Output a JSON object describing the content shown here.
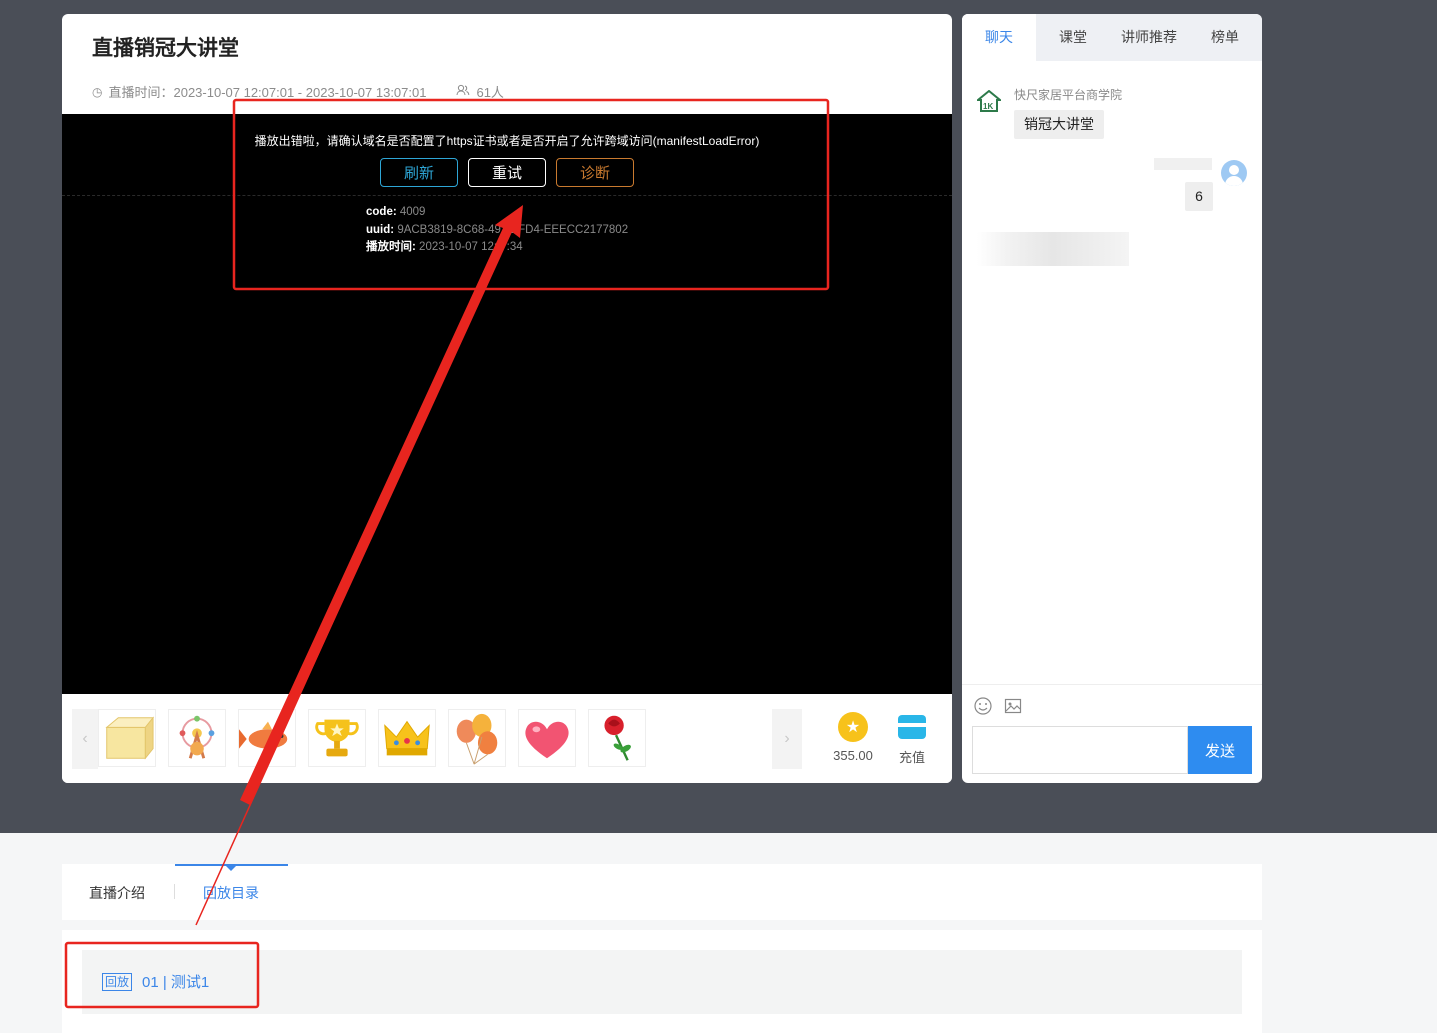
{
  "live": {
    "title": "直播销冠大讲堂",
    "time_label": "直播时间：2023-10-07 12:07:01 - 2023-10-07 13:07:01",
    "viewers": "61人"
  },
  "player_error": {
    "message": "播放出错啦，请确认域名是否配置了https证书或者是否开启了允许跨域访问(manifestLoadError)",
    "buttons": {
      "refresh": "刷新",
      "retry": "重试",
      "diagnose": "诊断"
    },
    "code_label": "code:",
    "code_value": "4009",
    "uuid_label": "uuid:",
    "uuid_value": "9ACB3819-8C68-491 BFD4-EEECC2177802",
    "time_label": "播放时间:",
    "time_value": "2023-10-07 12:2 :34"
  },
  "gifts": [
    "gift-box",
    "ferris-wheel",
    "koi-fish",
    "trophy",
    "crown",
    "balloons",
    "heart",
    "rose"
  ],
  "wallet": {
    "balance": "355.00",
    "recharge_label": "充值"
  },
  "chat": {
    "tabs": [
      "聊天",
      "课堂",
      "讲师推荐",
      "榜单"
    ],
    "active_tab": "聊天",
    "messages": [
      {
        "sender": "快尺家居平台商学院",
        "text": "销冠大讲堂"
      },
      {
        "sender": "",
        "text": "6"
      }
    ],
    "send_label": "发送",
    "icons": [
      "emoji-icon",
      "image-icon"
    ]
  },
  "lower": {
    "tabs": [
      "直播介绍",
      "回放目录"
    ],
    "active_tab": "回放目录",
    "replay_items": [
      {
        "tag": "回放",
        "title": "01 | 测试1"
      }
    ]
  },
  "colors": {
    "accent": "#3b86e8",
    "annotation": "#e8251f",
    "dark_bg": "#4a4e57"
  }
}
